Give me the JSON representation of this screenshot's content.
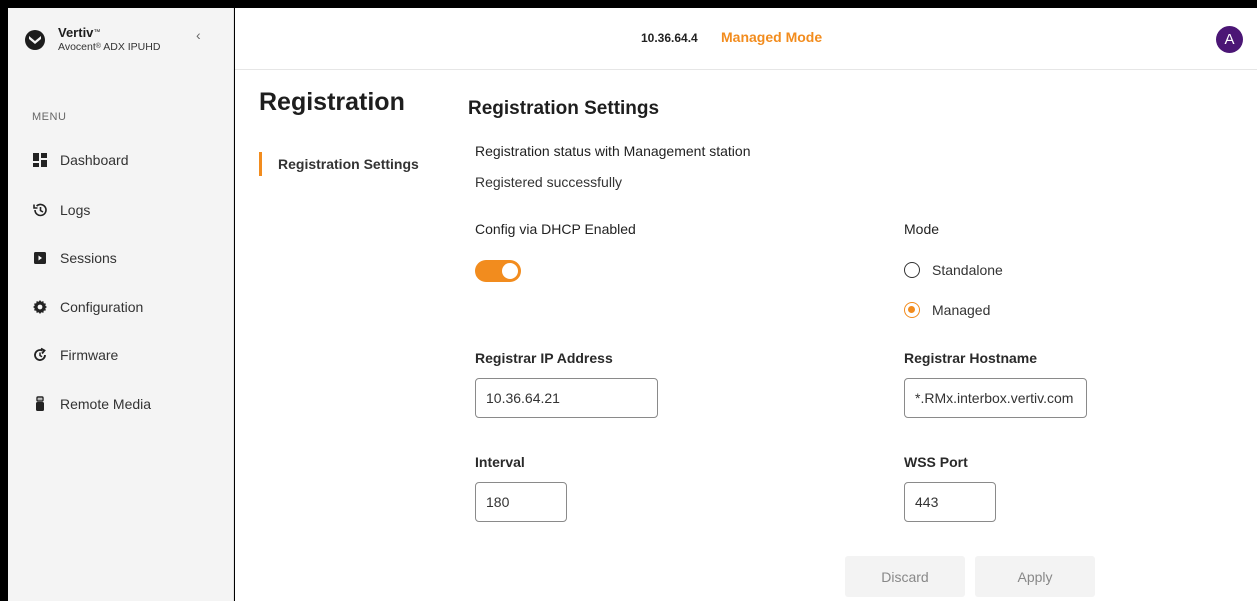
{
  "brand": {
    "name": "Vertiv",
    "name_mark": "™",
    "product_prefix": "Avocent",
    "product_mark": "®",
    "product_suffix": " ADX IPUHD"
  },
  "sidebar": {
    "menu_label": "MENU",
    "items": [
      {
        "label": "Dashboard",
        "icon": "dashboard-icon"
      },
      {
        "label": "Logs",
        "icon": "history-icon"
      },
      {
        "label": "Sessions",
        "icon": "sessions-icon"
      },
      {
        "label": "Configuration",
        "icon": "gear-icon"
      },
      {
        "label": "Firmware",
        "icon": "firmware-update-icon"
      },
      {
        "label": "Remote Media",
        "icon": "usb-icon"
      }
    ]
  },
  "header": {
    "ip": "10.36.64.4",
    "mode": "Managed Mode",
    "avatar_initial": "A"
  },
  "page": {
    "title": "Registration",
    "subnav": "Registration Settings"
  },
  "settings": {
    "title": "Registration Settings",
    "status_label": "Registration status with Management station",
    "status_value": "Registered successfully",
    "dhcp_label": "Config via DHCP Enabled",
    "dhcp_enabled": true,
    "mode_label": "Mode",
    "mode_options": [
      "Standalone",
      "Managed"
    ],
    "mode_selected": "Managed",
    "registrar_ip_label": "Registrar IP Address",
    "registrar_ip_value": "10.36.64.21",
    "registrar_hostname_label": "Registrar Hostname",
    "registrar_hostname_value": "*.RMx.interbox.vertiv.com",
    "interval_label": "Interval",
    "interval_value": "180",
    "wss_port_label": "WSS Port",
    "wss_port_value": "443"
  },
  "actions": {
    "discard": "Discard",
    "apply": "Apply"
  },
  "colors": {
    "accent": "#f28c1e",
    "avatar": "#4b1675"
  }
}
